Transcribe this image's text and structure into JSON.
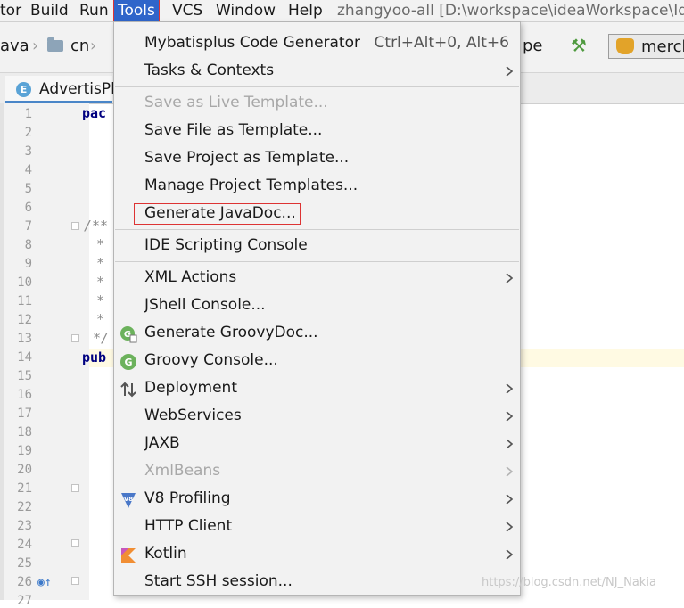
{
  "menubar": {
    "items": [
      "tor",
      "Build",
      "Run",
      "Tools",
      "VCS",
      "Window",
      "Help"
    ],
    "title": "zhangyoo-all [D:\\workspace\\ideaWorkspace\\Ide"
  },
  "navbar": {
    "crumbs": [
      "ava",
      "cn"
    ],
    "partial_right": "pe",
    "run_config": "merch"
  },
  "tab": {
    "label": "AdvertisPla",
    "icon_letter": "E"
  },
  "gutter": {
    "line_numbers": [
      "1",
      "2",
      "3",
      "4",
      "5",
      "6",
      "7",
      "8",
      "9",
      "10",
      "11",
      "12",
      "13",
      "14",
      "15",
      "16",
      "17",
      "18",
      "19",
      "20",
      "21",
      "22",
      "23",
      "24",
      "25",
      "26",
      "27"
    ]
  },
  "code": {
    "line1": "pac",
    "line7": "/**",
    "star": "*",
    "line13": "*/",
    "line14": "pub"
  },
  "tools_menu": {
    "items": [
      {
        "label": "Mybatisplus Code Generator",
        "shortcut": "Ctrl+Alt+0, Alt+6"
      },
      {
        "label": "Tasks & Contexts",
        "submenu": true
      },
      {
        "label": "Save as Live Template...",
        "disabled": true
      },
      {
        "label": "Save File as Template..."
      },
      {
        "label": "Save Project as Template..."
      },
      {
        "label": "Manage Project Templates..."
      },
      {
        "label": "Generate JavaDoc...",
        "highlighted": true
      },
      {
        "label": "IDE Scripting Console"
      },
      {
        "label": "XML Actions",
        "submenu": true
      },
      {
        "label": "JShell Console..."
      },
      {
        "label": "Generate GroovyDoc...",
        "icon": "groovy-doc-icon"
      },
      {
        "label": "Groovy Console...",
        "icon": "groovy-icon"
      },
      {
        "label": "Deployment",
        "submenu": true,
        "icon": "deployment-icon"
      },
      {
        "label": "WebServices",
        "submenu": true
      },
      {
        "label": "JAXB",
        "submenu": true
      },
      {
        "label": "XmlBeans",
        "submenu": true,
        "disabled": true
      },
      {
        "label": "V8 Profiling",
        "submenu": true,
        "icon": "v8-icon"
      },
      {
        "label": "HTTP Client",
        "submenu": true
      },
      {
        "label": "Kotlin",
        "submenu": true,
        "icon": "kotlin-icon"
      },
      {
        "label": "Start SSH session..."
      }
    ]
  },
  "watermark": "https://blog.csdn.net/NJ_Nakia",
  "colors": {
    "accent": "#2f65ca",
    "highlight_border": "#dd3333",
    "caret_line": "#fffae3"
  }
}
